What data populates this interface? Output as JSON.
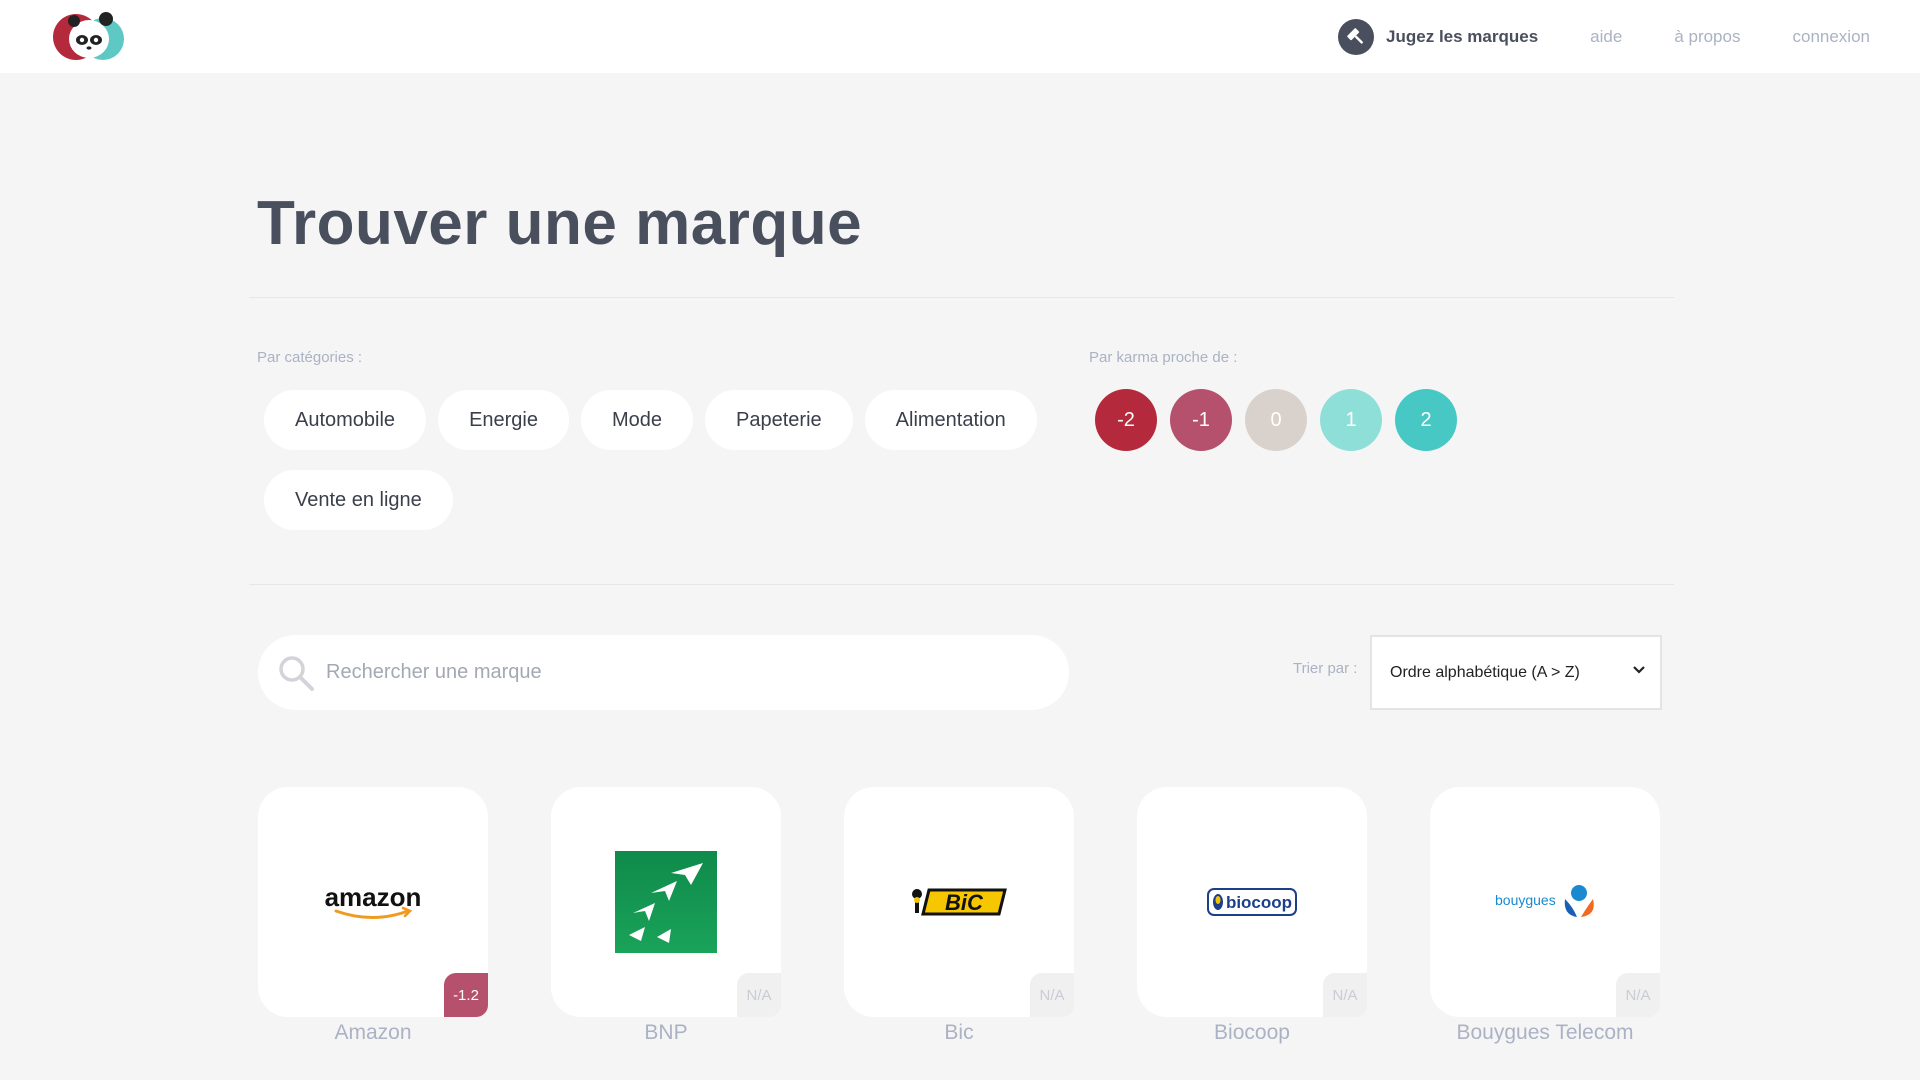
{
  "header": {
    "cta_label": "Jugez les marques",
    "links": [
      "aide",
      "à propos",
      "connexion"
    ]
  },
  "page_title": "Trouver une marque",
  "filters": {
    "categories_label": "Par catégories :",
    "categories": [
      "Automobile",
      "Energie",
      "Mode",
      "Papeterie",
      "Alimentation",
      "Vente en ligne"
    ],
    "karma_label": "Par karma proche de :",
    "karma": [
      {
        "value": "-2",
        "color": "#b42a3c"
      },
      {
        "value": "-1",
        "color": "#b5516d"
      },
      {
        "value": "0",
        "color": "#d9d2cc"
      },
      {
        "value": "1",
        "color": "#8fdfd9"
      },
      {
        "value": "2",
        "color": "#47c8c5"
      }
    ]
  },
  "search": {
    "placeholder": "Rechercher une marque"
  },
  "sort": {
    "label": "Trier par :",
    "value": "Ordre alphabétique (A > Z)"
  },
  "brands": [
    {
      "name": "Amazon",
      "score": "-1.2",
      "logo": "amazon-logo"
    },
    {
      "name": "BNP",
      "score": "N/A",
      "logo": "bnp-logo"
    },
    {
      "name": "Bic",
      "score": "N/A",
      "logo": "bic-logo"
    },
    {
      "name": "Biocoop",
      "score": "N/A",
      "logo": "biocoop-logo"
    },
    {
      "name": "Bouygues Telecom",
      "score": "N/A",
      "logo": "bouygues-logo"
    }
  ],
  "logo_text": {
    "amazon": "amazon",
    "bic": "BiC",
    "biocoop": "biocoop",
    "bouygues": "bouygues"
  }
}
